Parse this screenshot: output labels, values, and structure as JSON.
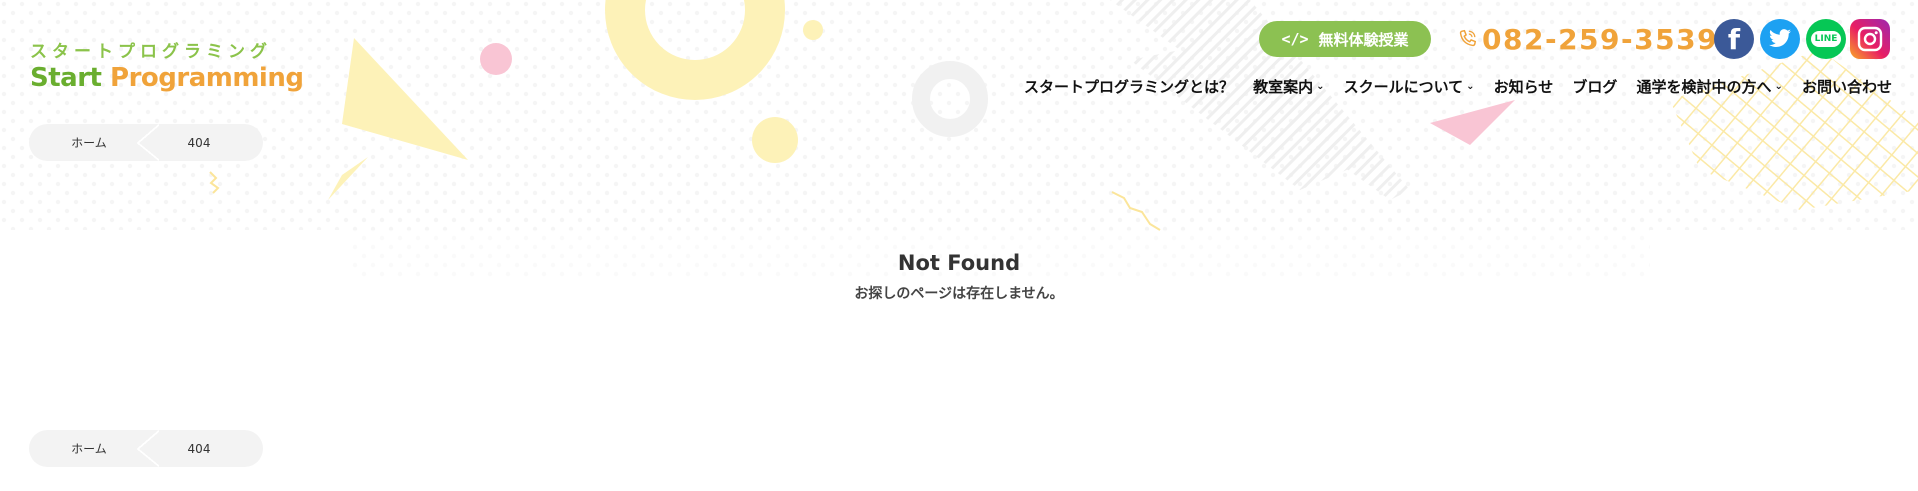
{
  "logo": {
    "kana": "スタートプログラミング",
    "word_start": "Start",
    "word_programming": "Programming"
  },
  "breadcrumb": {
    "home": "ホーム",
    "current": "404"
  },
  "header": {
    "trial_button": {
      "icon": "code-icon",
      "icon_text": "</>",
      "label": "無料体験授業"
    },
    "phone": {
      "icon": "phone-icon",
      "number": "082-259-3539"
    },
    "sns": [
      {
        "name": "facebook-icon",
        "glyph": "f"
      },
      {
        "name": "twitter-icon"
      },
      {
        "name": "line-icon",
        "glyph": "LINE"
      },
      {
        "name": "instagram-icon"
      }
    ]
  },
  "nav": [
    {
      "label": "スタートプログラミングとは？",
      "dropdown": false
    },
    {
      "label": "教室案内",
      "dropdown": true
    },
    {
      "label": "スクールについて",
      "dropdown": true
    },
    {
      "label": "お知らせ",
      "dropdown": false
    },
    {
      "label": "ブログ",
      "dropdown": false
    },
    {
      "label": "通学を検討中の方へ",
      "dropdown": true
    },
    {
      "label": "お問い合わせ",
      "dropdown": false
    }
  ],
  "main": {
    "title": "Not Found",
    "message": "お探しのページは存在しません。"
  },
  "colors": {
    "brand_green": "#8cc152",
    "brand_orange": "#f0a33a",
    "decor_yellow": "#fdf2b8",
    "decor_pink": "#f9c5d4"
  }
}
